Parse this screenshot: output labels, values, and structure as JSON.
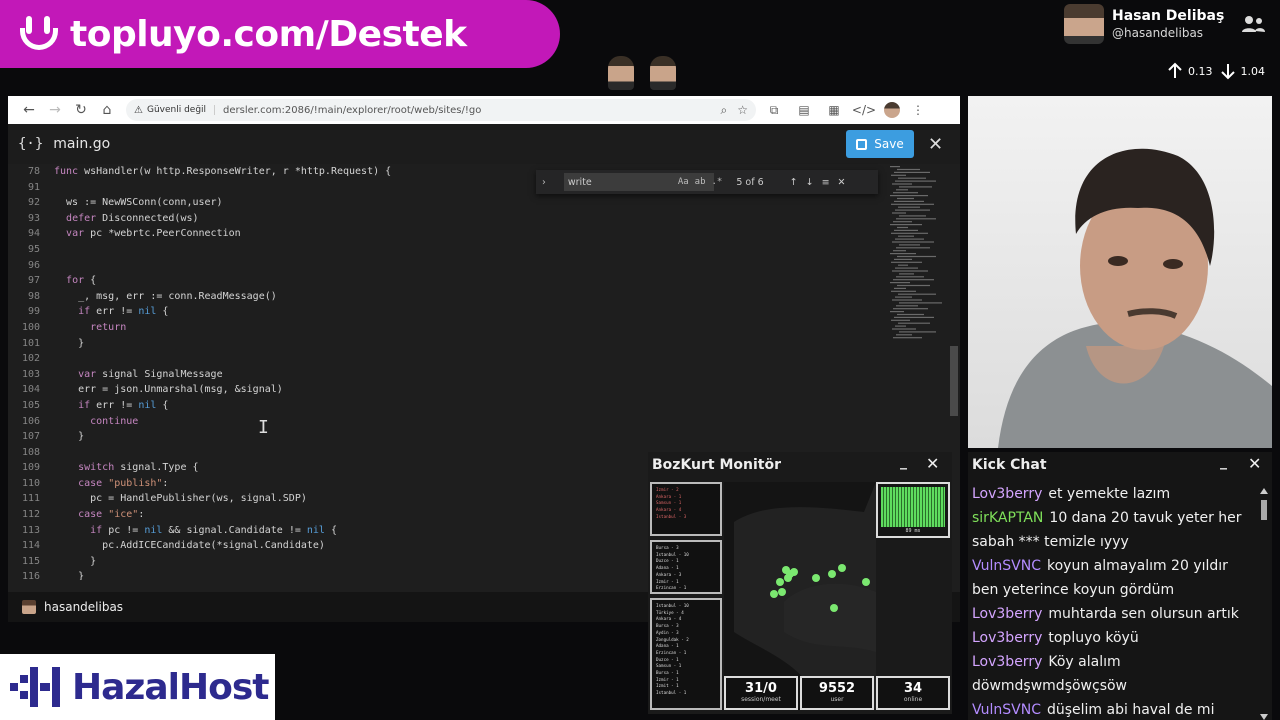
{
  "banner": {
    "text": "topluyo.com/Destek"
  },
  "profile": {
    "name": "Hasan Delibaş",
    "handle": "@hasandelibas",
    "up_value": "0.13",
    "down_value": "1.04"
  },
  "browser": {
    "security_label": "Güvenli değil",
    "url": "dersler.com:2086/!main/explorer/root/web/sites/!go"
  },
  "editor": {
    "file_name": "main.go",
    "save_label": "Save",
    "find": {
      "query": "write",
      "match_count": "5 of 6"
    },
    "code_lines": [
      {
        "n": "78",
        "t": "func wsHandler(w http.ResponseWriter, r *http.Request) {"
      },
      {
        "n": "91",
        "t": ""
      },
      {
        "n": "92",
        "t": "  ws := NewWSConn(conn,user)"
      },
      {
        "n": "93",
        "t": "  defer Disconnected(ws)"
      },
      {
        "n": "94",
        "t": "  var pc *webrtc.PeerConnection"
      },
      {
        "n": "95",
        "t": ""
      },
      {
        "n": "96",
        "t": ""
      },
      {
        "n": "97",
        "t": "  for {"
      },
      {
        "n": "98",
        "t": "    _, msg, err := conn.ReadMessage()"
      },
      {
        "n": "99",
        "t": "    if err != nil {"
      },
      {
        "n": "100",
        "t": "      return"
      },
      {
        "n": "101",
        "t": "    }"
      },
      {
        "n": "102",
        "t": ""
      },
      {
        "n": "103",
        "t": "    var signal SignalMessage"
      },
      {
        "n": "104",
        "t": "    err = json.Unmarshal(msg, &signal)"
      },
      {
        "n": "105",
        "t": "    if err != nil {"
      },
      {
        "n": "106",
        "t": "      continue"
      },
      {
        "n": "107",
        "t": "    }"
      },
      {
        "n": "108",
        "t": ""
      },
      {
        "n": "109",
        "t": "    switch signal.Type {"
      },
      {
        "n": "110",
        "t": "    case \"publish\":"
      },
      {
        "n": "111",
        "t": "      pc = HandlePublisher(ws, signal.SDP)"
      },
      {
        "n": "112",
        "t": "    case \"ice\":"
      },
      {
        "n": "113",
        "t": "      if pc != nil && signal.Candidate != nil {"
      },
      {
        "n": "114",
        "t": "        pc.AddICECandidate(*signal.Candidate)"
      },
      {
        "n": "115",
        "t": "      }"
      },
      {
        "n": "116",
        "t": "    }"
      }
    ],
    "status_user": "hasandelibas"
  },
  "monitor": {
    "title": "BozKurt Monitör",
    "graph_ms": "89 ms",
    "counters": [
      {
        "value": "31/0",
        "label": "session/meet"
      },
      {
        "value": "9552",
        "label": "user"
      },
      {
        "value": "34",
        "label": "online"
      }
    ],
    "list_top": [
      "Izmir - 2",
      "Ankara - 1",
      "Samsun - 1",
      "Ankara - 4",
      "Istanbul - 3"
    ],
    "list_mid": [
      "Bursa - 3",
      "Istanbul - 10",
      "Duzce - 1",
      "Adana - 1",
      "Ankara - 3",
      "Izmir - 1",
      "Erzincan - 1"
    ],
    "list_bot": [
      "Istanbul - 10",
      "Türkiye - 4",
      "Ankara - 4",
      "Bursa - 3",
      "Aydin - 3",
      "Zonguldak - 2",
      "Adana - 1",
      "Erzincan - 1",
      "Duzce - 1",
      "Samsun - 1",
      "Bursa - 1",
      "Izmir - 1",
      "Izmit - 1",
      "Istanbul - 1"
    ]
  },
  "chat": {
    "title": "Kick Chat",
    "messages": [
      {
        "user": "Lov3berry",
        "color": "#d4a5ff",
        "text": "et yemekte lazım"
      },
      {
        "user": "sirKAPTAN",
        "color": "#7fe05a",
        "text": "10 dana 20 tavuk yeter her sabah *** temizle ıyyy"
      },
      {
        "user": "VulnSVNC",
        "color": "#b38cff",
        "text": "koyun almayalım 20 yıldır ben yeterince koyun gördüm"
      },
      {
        "user": "Lov3berry",
        "color": "#d4a5ff",
        "text": "muhtarda sen olursun artık"
      },
      {
        "user": "Lov3berry",
        "color": "#d4a5ff",
        "text": "topluyo köyü"
      },
      {
        "user": "Lov3berry",
        "color": "#d4a5ff",
        "text": "Köy alalım döwmdşwmdşöwçsöw"
      },
      {
        "user": "VulnSVNC",
        "color": "#b38cff",
        "text": "düşelim abi haval de mi"
      }
    ]
  },
  "logo": {
    "text": "HazalHost"
  },
  "colors": {
    "banner": "#c218b8",
    "save": "#3c9de0",
    "logo": "#2d2a8e"
  }
}
